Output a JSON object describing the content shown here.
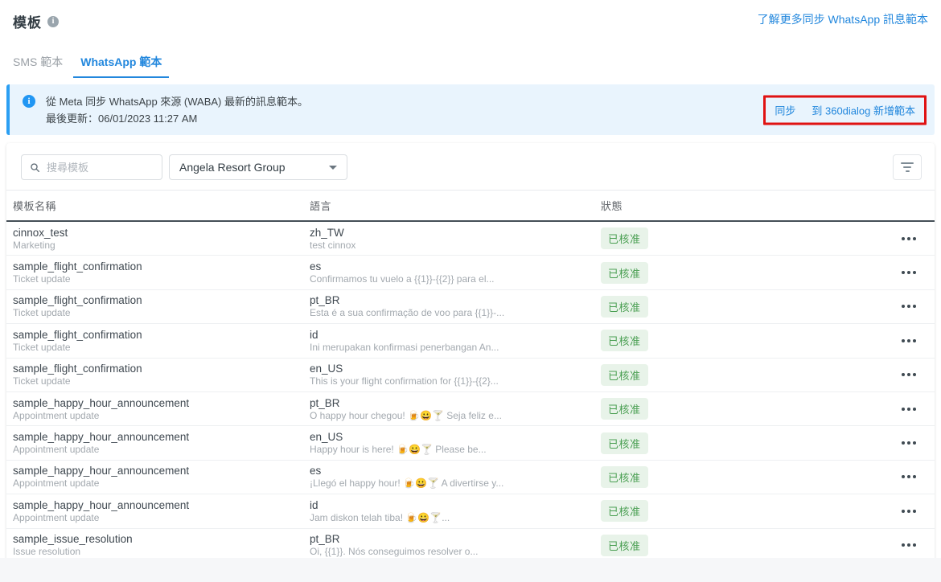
{
  "page": {
    "title": "模板",
    "learn_more_link": "了解更多同步 WhatsApp 訊息範本"
  },
  "tabs": [
    {
      "label": "SMS 範本",
      "active": false
    },
    {
      "label": "WhatsApp 範本",
      "active": true
    }
  ],
  "banner": {
    "line1": "從 Meta 同步 WhatsApp 來源 (WABA) 最新的訊息範本。",
    "line2": "最後更新：06/01/2023 11:27 AM",
    "sync_label": "同步",
    "add_template_label": "到 360dialog 新增範本"
  },
  "toolbar": {
    "search_placeholder": "搜尋模板",
    "account_selector_value": "Angela Resort Group"
  },
  "table": {
    "headers": {
      "name": "模板名稱",
      "language": "語言",
      "status": "狀態"
    },
    "rows": [
      {
        "name": "cinnox_test",
        "category": "Marketing",
        "language": "zh_TW",
        "preview": "test cinnox",
        "status": "已核准"
      },
      {
        "name": "sample_flight_confirmation",
        "category": "Ticket update",
        "language": "es",
        "preview": "Confirmamos tu vuelo a {{1}}-{{2}} para el...",
        "status": "已核准"
      },
      {
        "name": "sample_flight_confirmation",
        "category": "Ticket update",
        "language": "pt_BR",
        "preview": "Esta é a sua confirmação de voo para {{1}}-...",
        "status": "已核准"
      },
      {
        "name": "sample_flight_confirmation",
        "category": "Ticket update",
        "language": "id",
        "preview": "Ini merupakan konfirmasi penerbangan An...",
        "status": "已核准"
      },
      {
        "name": "sample_flight_confirmation",
        "category": "Ticket update",
        "language": "en_US",
        "preview": "This is your flight confirmation for {{1}}-{{2}...",
        "status": "已核准"
      },
      {
        "name": "sample_happy_hour_announcement",
        "category": "Appointment update",
        "language": "pt_BR",
        "preview": "O happy hour chegou! 🍺😀🍸 Seja feliz e...",
        "status": "已核准"
      },
      {
        "name": "sample_happy_hour_announcement",
        "category": "Appointment update",
        "language": "en_US",
        "preview": "Happy hour is here! 🍺😀🍸 Please be...",
        "status": "已核准"
      },
      {
        "name": "sample_happy_hour_announcement",
        "category": "Appointment update",
        "language": "es",
        "preview": "¡Llegó el happy hour! 🍺😀🍸 A divertirse y...",
        "status": "已核准"
      },
      {
        "name": "sample_happy_hour_announcement",
        "category": "Appointment update",
        "language": "id",
        "preview": "Jam diskon telah tiba! 🍺😀🍸...",
        "status": "已核准"
      },
      {
        "name": "sample_issue_resolution",
        "category": "Issue resolution",
        "language": "pt_BR",
        "preview": "Oi, {{1}}. Nós conseguimos resolver o...",
        "status": "已核准"
      }
    ]
  },
  "colors": {
    "accent_blue": "#2287dd",
    "banner_background": "#e9f4fd",
    "banner_border": "#2b9ff3",
    "badge_background": "#e8f3e9",
    "badge_text": "#4a9f52",
    "annotation_red": "#e01212"
  }
}
